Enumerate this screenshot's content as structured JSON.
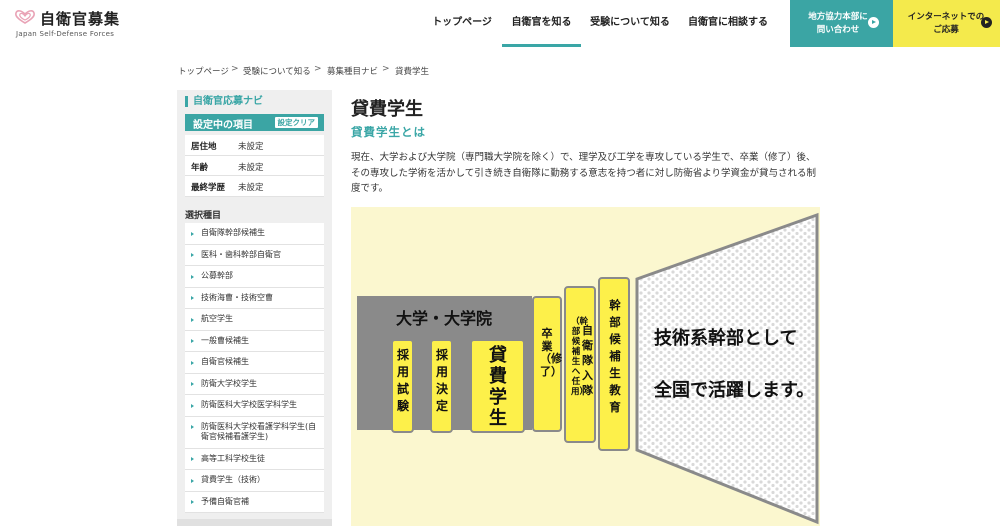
{
  "header": {
    "logo_title": "自衛官募集",
    "logo_subtitle": "Japan Self-Defense Forces",
    "nav": [
      "トップページ",
      "自衛官を知る",
      "受験について知る",
      "自衛官に相談する"
    ],
    "active_nav": "自衛官を知る",
    "cta_inquiry": [
      "地方協力本部に",
      "問い合わせ"
    ],
    "cta_apply": [
      "インターネットでの",
      "ご応募"
    ]
  },
  "breadcrumb": [
    "トップページ",
    "受験について知る",
    "募集種目ナビ",
    "貸費学生"
  ],
  "sidebar": {
    "title": "自衛官応募ナビ",
    "settings_label": "設定中の項目",
    "clear_label": "設定クリア",
    "settings": [
      {
        "key": "居住地",
        "value": "未設定"
      },
      {
        "key": "年齢",
        "value": "未設定"
      },
      {
        "key": "最終学歴",
        "value": "未設定"
      }
    ],
    "selection_label": "選択種目",
    "items": [
      "自衛隊幹部候補生",
      "医科・歯科幹部自衛官",
      "公募幹部",
      "技術海曹・技術空曹",
      "航空学生",
      "一般曹候補生",
      "自衛官候補生",
      "防衛大学校学生",
      "防衛医科大学校医学科学生",
      "防衛医科大学校看護学科学生(自衛官候補看護学生)",
      "高等工科学校生徒",
      "貸費学生（技術）",
      "予備自衛官補"
    ]
  },
  "main": {
    "title": "貸費学生",
    "subtitle": "貸費学生とは",
    "description": "現在、大学および大学院（専門職大学院を除く）で、理学及び工学を専攻している学生で、卒業（修了）後、その専攻した学術を活かして引き続き自衛隊に勤務する意志を持つ者に対し防衛省より学資金が貸与される制度です。"
  },
  "diagram": {
    "band_label": "大学・大学院",
    "step1": "採用試験",
    "step2": "採用決定",
    "step3": "貸費学生",
    "step4": "卒業（修了）",
    "step5_main": "自衛隊入隊",
    "step5_sub": "（幹部候補生へ任用）",
    "step6": "幹部候補生教育",
    "outcome_line1": "技術系幹部として",
    "outcome_line2": "全国で活躍します。",
    "colors": {
      "yellow": "#fdf04a",
      "gray": "#8a8a8a",
      "bg": "#fbf7cf"
    }
  },
  "colors": {
    "teal": "#3ba5a4",
    "yellow": "#f4ea4c"
  }
}
